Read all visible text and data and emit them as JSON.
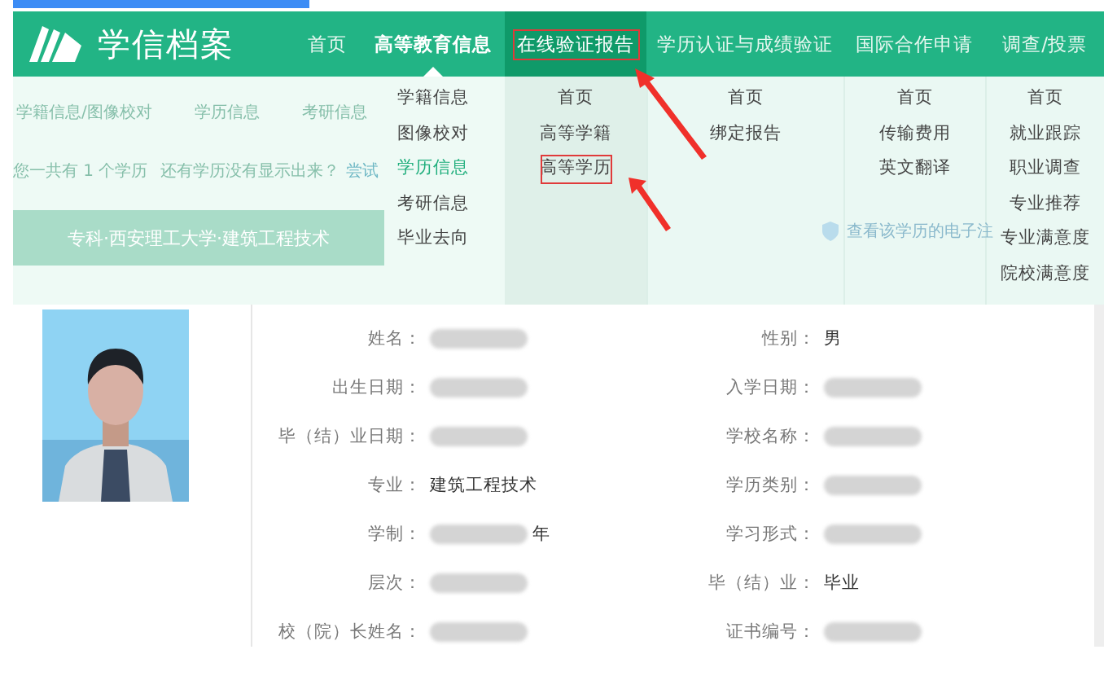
{
  "header": {
    "logo_text": "学信档案",
    "nav": [
      {
        "label": "首页",
        "selected": false,
        "expanded": false,
        "highlighted": false
      },
      {
        "label": "高等教育信息",
        "selected": false,
        "expanded": true,
        "highlighted": false,
        "menu": [
          {
            "label": "学籍信息",
            "selected": false,
            "highlighted": false
          },
          {
            "label": "图像校对",
            "selected": false,
            "highlighted": false
          },
          {
            "label": "学历信息",
            "selected": true,
            "highlighted": false
          },
          {
            "label": "考研信息",
            "selected": false,
            "highlighted": false
          },
          {
            "label": "毕业去向",
            "selected": false,
            "highlighted": false
          }
        ]
      },
      {
        "label": "在线验证报告",
        "selected": true,
        "expanded": false,
        "highlighted": true,
        "menu": [
          {
            "label": "首页",
            "selected": false,
            "highlighted": false
          },
          {
            "label": "高等学籍",
            "selected": false,
            "highlighted": false
          },
          {
            "label": "高等学历",
            "selected": false,
            "highlighted": true
          }
        ]
      },
      {
        "label": "学历认证与成绩验证",
        "selected": false,
        "expanded": false,
        "highlighted": false,
        "menu": [
          {
            "label": "首页",
            "selected": false,
            "highlighted": false
          },
          {
            "label": "绑定报告",
            "selected": false,
            "highlighted": false
          }
        ]
      },
      {
        "label": "国际合作申请",
        "selected": false,
        "expanded": false,
        "highlighted": false,
        "menu": [
          {
            "label": "首页",
            "selected": false,
            "highlighted": false
          },
          {
            "label": "传输费用",
            "selected": false,
            "highlighted": false
          },
          {
            "label": "英文翻译",
            "selected": false,
            "highlighted": false
          }
        ]
      },
      {
        "label": "调查/投票",
        "selected": false,
        "expanded": false,
        "highlighted": false,
        "menu": [
          {
            "label": "首页",
            "selected": false,
            "highlighted": false
          },
          {
            "label": "就业跟踪",
            "selected": false,
            "highlighted": false
          },
          {
            "label": "职业调查",
            "selected": false,
            "highlighted": false
          },
          {
            "label": "专业推荐",
            "selected": false,
            "highlighted": false
          },
          {
            "label": "专业满意度",
            "selected": false,
            "highlighted": false
          },
          {
            "label": "院校满意度",
            "selected": false,
            "highlighted": false
          }
        ]
      }
    ]
  },
  "background": {
    "tabs": [
      "学籍信息/图像校对",
      "学历信息",
      "考研信息"
    ],
    "count_text": "您一共有 1 个学历",
    "missing_text": "还有学历没有显示出来？",
    "try_link": "尝试",
    "degree_banner": "专科·西安理工大学·建筑工程技术",
    "registration_link": "查看该学历的电子注"
  },
  "record": {
    "fields": [
      {
        "label": "姓名：",
        "redacted": true
      },
      {
        "label": "性别：",
        "value": "男",
        "redacted": false
      },
      {
        "label": "出生日期：",
        "redacted": true
      },
      {
        "label": "入学日期：",
        "redacted": true
      },
      {
        "label": "毕（结）业日期：",
        "redacted": true
      },
      {
        "label": "学校名称：",
        "redacted": true
      },
      {
        "label": "专业：",
        "value": "建筑工程技术",
        "redacted": false
      },
      {
        "label": "学历类别：",
        "redacted": true
      },
      {
        "label": "学制：",
        "value": "年",
        "redacted": true
      },
      {
        "label": "学习形式：",
        "redacted": true
      },
      {
        "label": "层次：",
        "redacted": true
      },
      {
        "label": "毕（结）业：",
        "value": "毕业",
        "redacted": false
      },
      {
        "label": "校（院）长姓名：",
        "redacted": true
      },
      {
        "label": "证书编号：",
        "redacted": true
      }
    ]
  }
}
